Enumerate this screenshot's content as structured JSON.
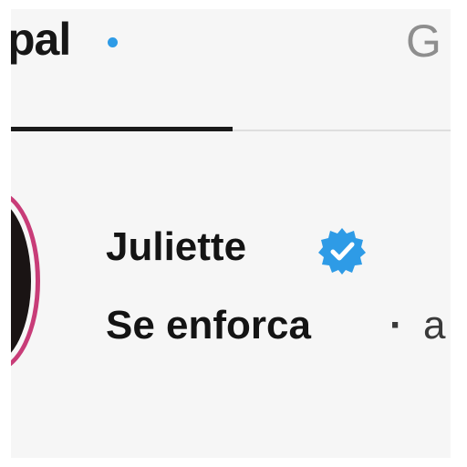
{
  "tabs": {
    "primary_label": "pal",
    "general_label": "G"
  },
  "conversation": {
    "name": "Juliette",
    "preview": "Se enforca",
    "separator": "·",
    "time": "a",
    "verified_icon": "verified-badge-icon",
    "badge_color": "#2e9be6",
    "ring_color": "#c83c78"
  }
}
